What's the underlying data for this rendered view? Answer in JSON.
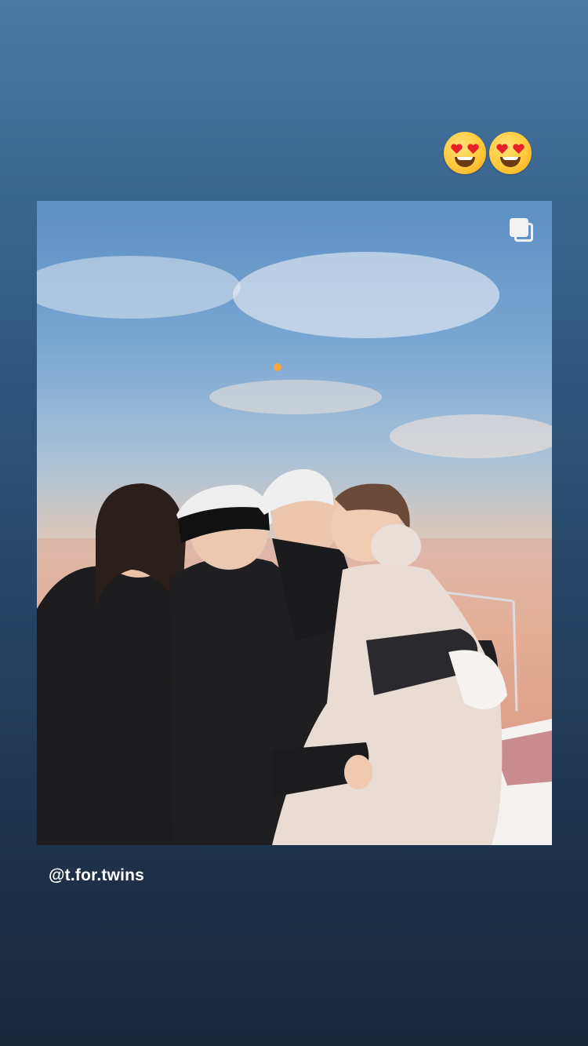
{
  "story": {
    "stickers": [
      {
        "icon": "heart-eyes-emoji"
      },
      {
        "icon": "heart-eyes-emoji"
      }
    ],
    "post": {
      "multi_photo_indicator": "carousel-icon"
    },
    "mention": "@t.for.twins"
  },
  "colors": {
    "background_top": "#4a7aa6",
    "background_bottom": "#18263a",
    "mention_text": "#ffffff"
  }
}
